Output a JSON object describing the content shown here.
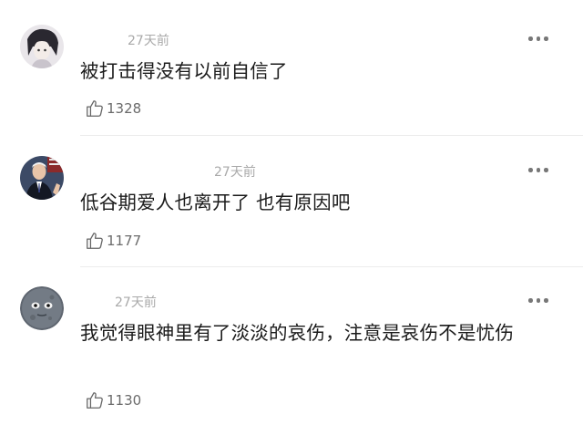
{
  "comments": [
    {
      "time": "27天前",
      "text": "被打击得没有以前自信了",
      "likes": "1328",
      "avatar": "anime-avatar"
    },
    {
      "time": "27天前",
      "text": "低谷期爱人也离开了 也有原因吧",
      "likes": "1177",
      "avatar": "man-suit-avatar"
    },
    {
      "time": "27天前",
      "text": "我觉得眼神里有了淡淡的哀伤，注意是哀伤不是忧伤",
      "likes": "1130",
      "avatar": "moon-face-avatar"
    }
  ],
  "icons": {
    "more": "more-dots-icon",
    "like": "thumbs-up-icon"
  }
}
